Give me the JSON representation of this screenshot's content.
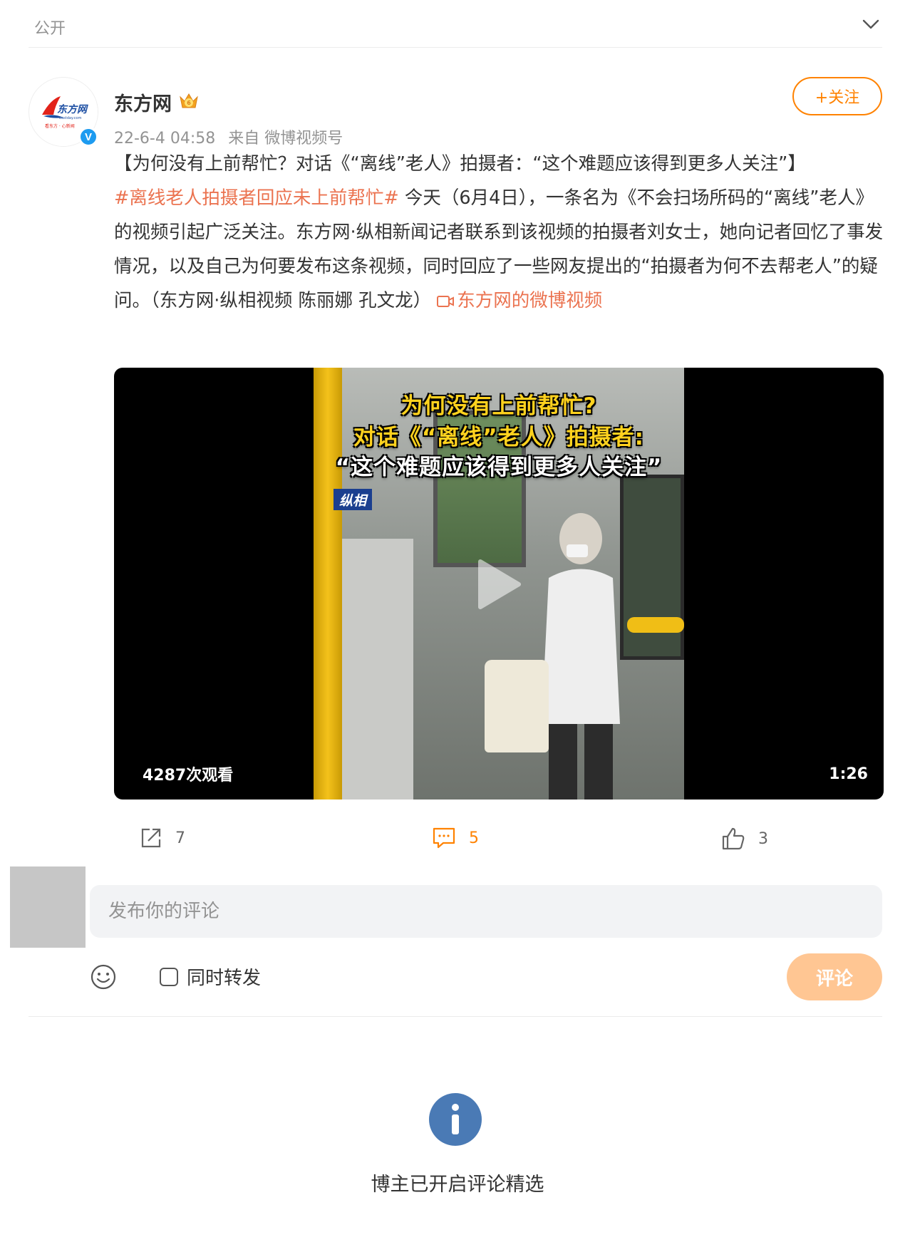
{
  "header": {
    "visibility": "公开",
    "expand_icon": "chevron-down-icon"
  },
  "post": {
    "author": {
      "name": "东方网",
      "avatar_text": "东方网",
      "avatar_subtext": "eastday.com",
      "verified_badge": "V"
    },
    "follow_label": "+关注",
    "time": "22-6-4 04:58",
    "source": "来自 微博视频号",
    "content": {
      "title": "【为何没有上前帮忙？对话《“离线”老人》拍摄者：“这个难题应该得到更多人关注”】",
      "hashtag": "#离线老人拍摄者回应未上前帮忙#",
      "body": " 今天（6月4日），一条名为《不会扫场所码的“离线”老人》的视频引起广泛关注。东方网·纵相新闻记者联系到该视频的拍摄者刘女士，她向记者回忆了事发情况，以及自己为何要发布这条视频，同时回应了一些网友提出的“拍摄者为何不去帮老人”的疑问。（东方网·纵相视频 陈丽娜 孔文龙） ",
      "video_link": "东方网的微博视频"
    },
    "video": {
      "caption_line1": "为何没有上前帮忙?",
      "caption_line2": "对话《“离线”老人》拍摄者:",
      "caption_line3": "“这个难题应该得到更多人关注”",
      "watermark": "纵相",
      "views": "4287次观看",
      "duration": "1:26"
    },
    "actions": {
      "shares": "7",
      "comments": "5",
      "likes": "3"
    }
  },
  "comment_box": {
    "placeholder": "发布你的评论",
    "repost_label": "同时转发",
    "submit_label": "评论"
  },
  "notice": "博主已开启评论精选",
  "colors": {
    "accent": "#ff8200",
    "link": "#eb7350",
    "info": "#4a7ab5"
  }
}
